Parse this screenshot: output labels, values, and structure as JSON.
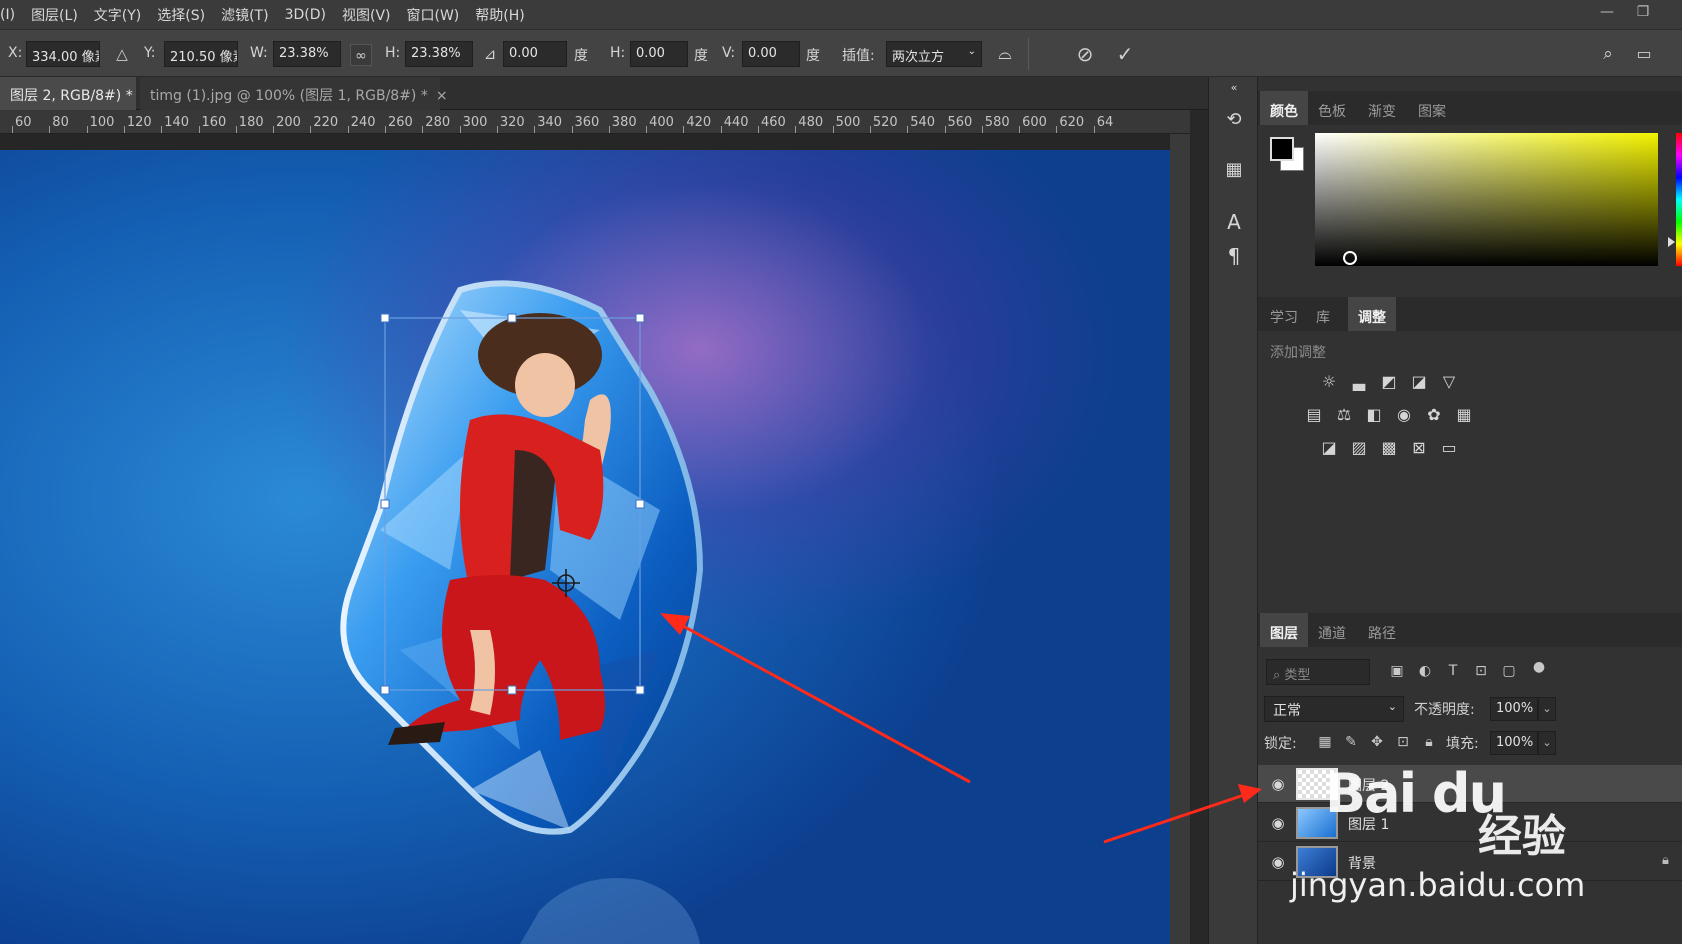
{
  "menu": {
    "items": [
      "(I)",
      "图层(L)",
      "文字(Y)",
      "选择(S)",
      "滤镜(T)",
      "3D(D)",
      "视图(V)",
      "窗口(W)",
      "帮助(H)"
    ],
    "minimize_icon": "minimize-icon",
    "restore_icon": "restore-icon"
  },
  "options": {
    "x_label": "X:",
    "x_value": "334.00 像素",
    "y_label": "Y:",
    "y_value": "210.50 像素",
    "w_label": "W:",
    "w_value": "23.38%",
    "h_label": "H:",
    "h_value": "23.38%",
    "angle_value": "0.00",
    "angle_unit": "度",
    "hskew_label": "H:",
    "hskew_value": "0.00",
    "hskew_unit": "度",
    "vskew_label": "V:",
    "vskew_value": "0.00",
    "vskew_unit": "度",
    "interp_label": "插值:",
    "interp_value": "两次立方"
  },
  "tabs": [
    {
      "label": "图层 2, RGB/8#) *",
      "close": "×"
    },
    {
      "label": "timg (1).jpg @ 100% (图层 1, RGB/8#) *",
      "close": "×"
    }
  ],
  "ruler": {
    "labels": [
      "60",
      "80",
      "100",
      "120",
      "140",
      "160",
      "180",
      "200",
      "220",
      "240",
      "260",
      "280",
      "300",
      "320",
      "340",
      "360",
      "380",
      "400",
      "420",
      "440",
      "460",
      "480",
      "500",
      "520",
      "540",
      "560",
      "580",
      "600",
      "620",
      "64"
    ]
  },
  "panels": {
    "color_tabs": [
      "颜色",
      "色板",
      "渐变",
      "图案"
    ],
    "adj_tabs": [
      "学习",
      "库",
      "调整"
    ],
    "adj_title": "添加调整",
    "layer_tabs": [
      "图层",
      "通道",
      "路径"
    ]
  },
  "layers": {
    "filter_placeholder": "类型",
    "blend_mode": "正常",
    "opacity_label": "不透明度:",
    "opacity_value": "100%",
    "lock_label": "锁定:",
    "fill_label": "填充:",
    "fill_value": "100%",
    "rows": [
      {
        "name": "图层 2",
        "selected": true
      },
      {
        "name": "图层 1",
        "selected": false
      },
      {
        "name": "背景",
        "selected": false
      }
    ]
  },
  "watermark": {
    "logo_text": "Bai du",
    "cn_text": "经验",
    "url_text": "jingyan.baidu.com"
  },
  "colors": {
    "foreground": "#000000",
    "background": "#ffffff",
    "annotation_arrow": "#ff2a1a",
    "transform_box": "#6a9fe0"
  }
}
